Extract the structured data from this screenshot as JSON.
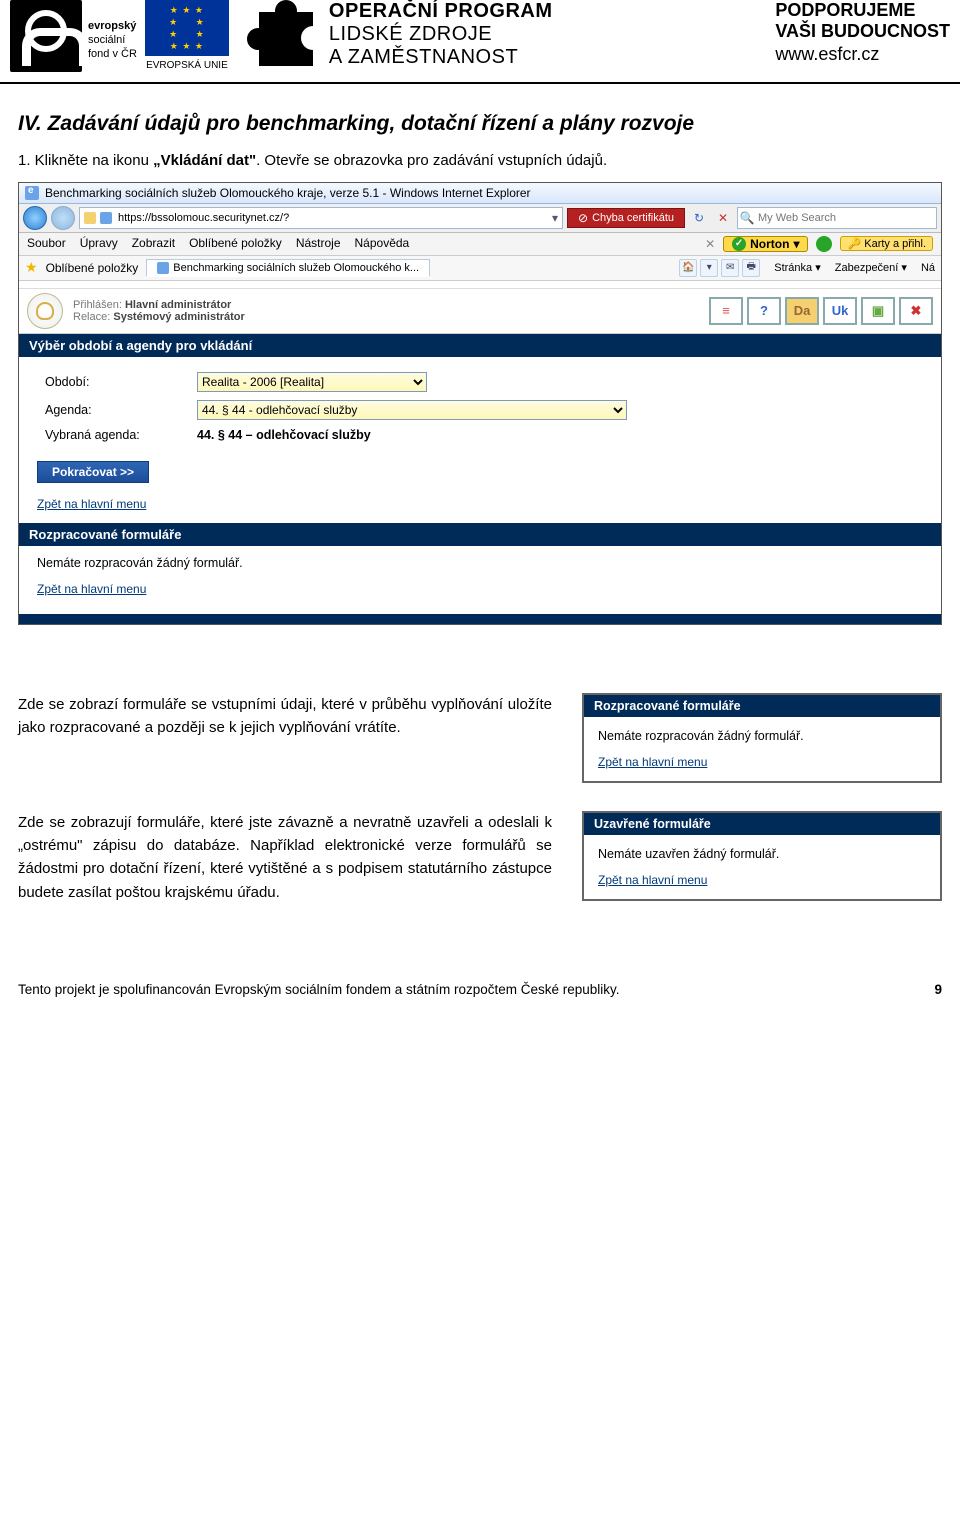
{
  "logos": {
    "esf_lines": [
      "evropský",
      "sociální",
      "fond v ČR"
    ],
    "eu_label": "EVROPSKÁ UNIE",
    "op_line1": "OPERAČNÍ PROGRAM",
    "op_line2": "LIDSKÉ ZDROJE",
    "op_line3": "A ZAMĚSTNANOST",
    "support_l1": "PODPORUJEME",
    "support_l2": "VAŠI BUDOUCNOST",
    "support_l3": "www.esfcr.cz"
  },
  "doc": {
    "heading": "IV. Zadávání údajů pro benchmarking, dotační řízení a plány rozvoje",
    "intro_pre": "1. Klikněte na ikonu ",
    "intro_bold": "„Vkládání dat\"",
    "intro_post": ". Otevře se obrazovka pro zadávání vstupních údajů.",
    "para2": "Zde se zobrazí formuláře se vstupními údaji, které v průběhu vyplňování uložíte jako rozpracované a později se k jejich vyplňování vrátíte.",
    "para3": "Zde se zobrazují formuláře, které jste závazně a nevratně uzavřeli a odeslali k „ostrému\" zápisu do databáze. Například elektronické verze formulářů se žádostmi pro dotační řízení, které vytištěné a s podpisem statutárního zástupce budete zasílat poštou krajskému úřadu.",
    "footer": "Tento projekt je spolufinancován Evropským sociálním fondem a státním rozpočtem České republiky.",
    "page": "9"
  },
  "shot": {
    "title": "Benchmarking sociálních služeb Olomouckého kraje, verze 5.1 - Windows Internet Explorer",
    "url": "https://bssolomouc.securitynet.cz/?",
    "cert": "Chyba certifikátu",
    "search_ph": "My Web Search",
    "menu": [
      "Soubor",
      "Úpravy",
      "Zobrazit",
      "Oblíbené položky",
      "Nástroje",
      "Nápověda"
    ],
    "norton": "Norton",
    "karty": "Karty a přihl.",
    "fav_label": "Oblíbené položky",
    "tab": "Benchmarking sociálních služeb Olomouckého k...",
    "tb_items": [
      "Stránka ▾",
      "Zabezpečení ▾",
      "Ná"
    ],
    "app_login_label": "Přihlášen:",
    "app_login_val": "Hlavní administrátor",
    "app_rel_label": "Relace:",
    "app_rel_val": "Systémový administrátor",
    "section1": "Výběr období a agendy pro vkládání",
    "obdobi_label": "Období:",
    "obdobi_val": "Realita - 2006 [Realita]",
    "agenda_label": "Agenda:",
    "agenda_val": "44. § 44 - odlehčovací služby",
    "vybrana_label": "Vybraná agenda:",
    "vybrana_val": "44. § 44 – odlehčovací služby",
    "btn_continue": "Pokračovat >>",
    "back": "Zpět na hlavní menu",
    "section2": "Rozpracované formuláře",
    "section2_msg": "Nemáte rozpracován žádný formulář.",
    "section3": "Uzavřené formuláře",
    "section3_msg": "Nemáte uzavřen žádný formulář."
  }
}
